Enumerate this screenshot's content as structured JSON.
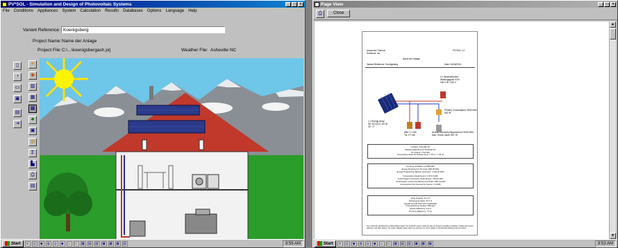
{
  "main_window": {
    "title": "PV*SOL - Simulation and Design of Photovoltaic Systems",
    "menu": [
      "File",
      "Conditions",
      "Appliances",
      "System",
      "Calculation",
      "Results",
      "Databases",
      "Options",
      "Language",
      "Help"
    ],
    "variant_label": "Variant Reference:",
    "variant_value": "Koenigsberg",
    "project_name_label": "Project Name:",
    "project_name_value": "Name der Anlage",
    "project_file_label": "Project File:",
    "project_file_value": "C:\\...\\koenigsbergash.prj",
    "weather_label": "Weather File:",
    "weather_value": "Asheville NC"
  },
  "page_view": {
    "title": "Page View",
    "close_label": "Close",
    "doc": {
      "company_line1": "Advanced Thermal",
      "company_line2": "Solutions, Inc.",
      "product": "PV*SOL 2.2",
      "project": "Name der Anlage",
      "variant": "Variant Reference: Koenigsberg",
      "date": "Date: 04/06/2001",
      "inverter_label": "4 x Wechselrichter",
      "inverter_specs1": "Wirkungsgrad: 91%",
      "inverter_specs2": "300.0 W / 230 V",
      "meter_label": "Primary Consumption: 5940 kWh",
      "meter_sub": "500 W",
      "pv_array_label": "1 x Energy Array",
      "pv_array_sub1": "SE-110 (A) 0.110 W",
      "pv_array_sub2": "30°, 0°",
      "ph_label": "Max: 0.7 kW",
      "ph_sub": "Tot: 0.7 kW",
      "annual_label": "Annual Electricity Requirement: 5032 kWh",
      "annual_sub": "Max. Hourly Value: 827 W",
      "box1": [
        "Location: Asheville NC",
        "Weather Data Record: Asheville NC",
        "PV Output: 770.0 Wp",
        "Gross/Active Solar PV Surface Area: 7.25 m² / 7.25 m²"
      ],
      "box2": [
        "PV Array Irradiation: 12,685 kWh",
        "Energy Produced by PV Array: 890.28 kWh",
        "Energy Produced by Backup Generator: 1,204.46 kWh",
        "",
        "Consumption Requirement: 1,673.0 kWh",
        "Consumption Covered by Solar Energy: 725.62 kWh",
        "Consumption Covered by Backup Generator: 966.73 kWh",
        "Consumption Not Covered by System: 0.0 kWh"
      ],
      "box3": [
        "Solar Fraction: 44.3 %",
        "Performance Ratio: 54.7 %",
        "Specific Annual Yield: 872.0 kWh/kWp",
        "CO2 Emissions avoided: 456 kg/a",
        "System Efficiency: 6.0 %",
        "PV Array Efficiency: 7.5 %"
      ],
      "footnote": "The results are calculated by a mathematical model. The actual PV system yields can vary on account of weather conditions, module and inverter efficiency, and other factors. The system diagram above does not represent, nor can it replace, a full technical drawing of the PV system."
    }
  },
  "taskbar_left": {
    "start_label": "Start",
    "clock": "8:56 AM"
  },
  "taskbar_right": {
    "start_label": "Start",
    "clock": "8:53 AM"
  },
  "colors": {
    "titlebar": "#000080",
    "sky": "#6ec6e8",
    "grass": "#2a9d2a",
    "roof": "#c0392b",
    "sun": "#ffe000"
  }
}
